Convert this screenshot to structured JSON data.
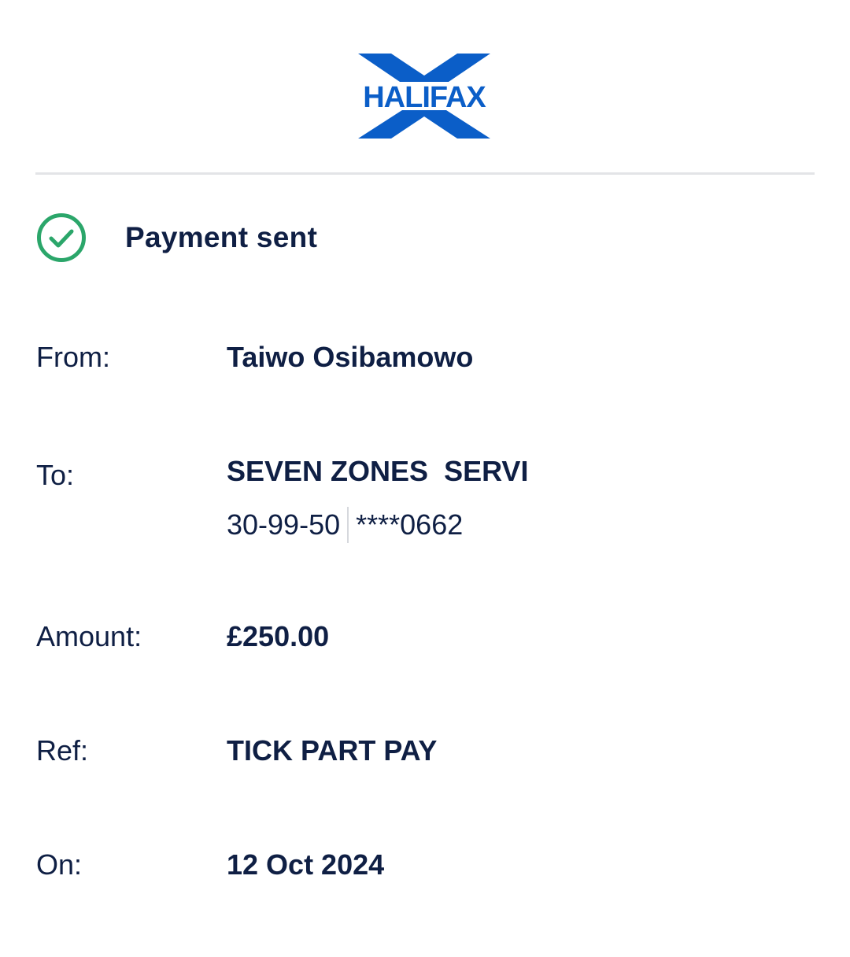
{
  "brand": {
    "name": "HALIFAX",
    "color": "#0b5ec8"
  },
  "status": {
    "icon": "check-circle-icon",
    "text": "Payment sent",
    "color": "#2ba66a"
  },
  "details": {
    "from": {
      "label": "From:",
      "value": "Taiwo Osibamowo"
    },
    "to": {
      "label": "To:",
      "payee": "SEVEN ZONES  SERVI",
      "sort_code": "30-99-50",
      "account": "****0662"
    },
    "amount": {
      "label": "Amount:",
      "value": "£250.00"
    },
    "ref": {
      "label": "Ref:",
      "value": "TICK PART PAY"
    },
    "on": {
      "label": "On:",
      "value": "12 Oct 2024"
    }
  }
}
